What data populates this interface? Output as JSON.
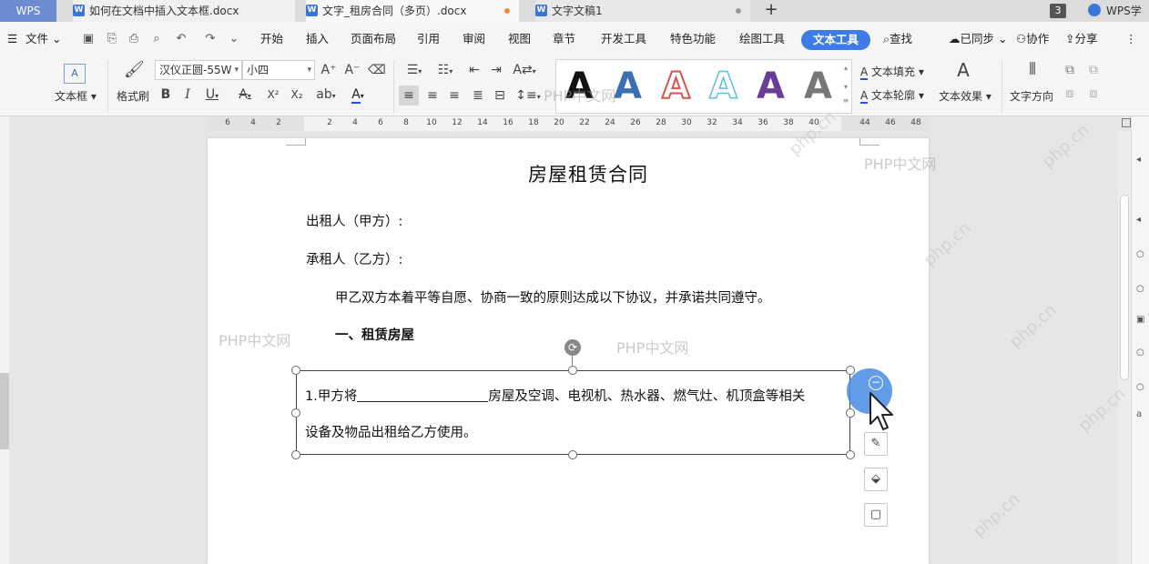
{
  "tabs": {
    "app": "WPS",
    "items": [
      {
        "label": "如何在文档中插入文本框.docx"
      },
      {
        "label": "文字_租房合同（多页）.docx"
      },
      {
        "label": "文字文稿1"
      }
    ],
    "add": "+",
    "window_count": "3",
    "academy": "WPS学"
  },
  "menu": {
    "file": "文件",
    "items": [
      "开始",
      "插入",
      "页面布局",
      "引用",
      "审阅",
      "视图",
      "章节",
      "开发工具",
      "特色功能",
      "绘图工具",
      "文本工具"
    ],
    "search": "查找",
    "synced": "已同步",
    "collab": "协作",
    "share": "分享"
  },
  "ribbon": {
    "textbox": "文本框",
    "format_painter": "格式刷",
    "font_name": "汉仪正圆-55W",
    "font_size": "小四",
    "bold": "B",
    "italic": "I",
    "underline": "U",
    "strike": "A",
    "superscript": "X²",
    "subscript": "X₂",
    "grow_font": "A⁺",
    "shrink_font": "A⁻",
    "text_fill": "文本填充",
    "text_outline": "文本轮廓",
    "text_effect": "文本效果",
    "text_direction": "文字方向",
    "art_letter": "A",
    "art_colors": [
      "#111111",
      "#3a6fb5",
      "#d9534f",
      "#5bc0de",
      "#6a3d9a",
      "#666666"
    ]
  },
  "ruler": {
    "ticks": [
      "6",
      "4",
      "2",
      "2",
      "4",
      "6",
      "8",
      "10",
      "12",
      "14",
      "16",
      "18",
      "20",
      "22",
      "24",
      "26",
      "28",
      "30",
      "32",
      "34",
      "36",
      "38",
      "40",
      "44",
      "46",
      "48"
    ]
  },
  "document": {
    "title": "房屋租赁合同",
    "lessor": "出租人（甲方）:",
    "lessee": "承租人（乙方）:",
    "intro": "甲乙双方本着平等自愿、协商一致的原则达成以下协议，并承诺共同遵守。",
    "section1": "一、租赁房屋",
    "textbox_line1_a": "1.甲方将",
    "textbox_line1_b": "房屋及空调、电视机、热水器、燃气灶、机顶盒等相关",
    "textbox_line2": "设备及物品出租给乙方使用。"
  },
  "watermark": {
    "text1": "PHP中文网",
    "text2": "php.cn"
  },
  "colors": {
    "accent": "#3e7be6",
    "tab_blue": "#6c8bd1"
  }
}
